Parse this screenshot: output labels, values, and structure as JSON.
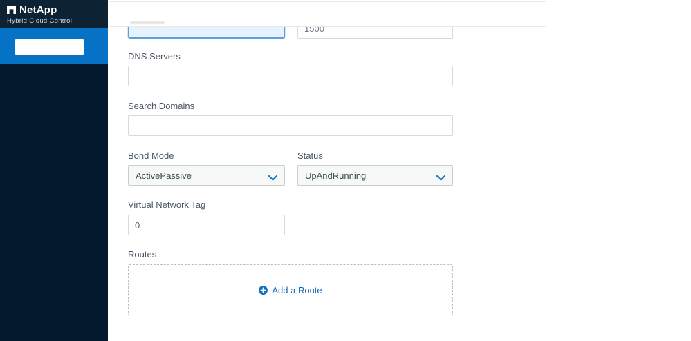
{
  "app": {
    "brand": "NetApp",
    "product": "Hybrid Cloud Control"
  },
  "form": {
    "row1": {
      "focused_value": "",
      "mtu_value": "1500"
    },
    "dns_servers": {
      "label": "DNS Servers",
      "value": ""
    },
    "search_domains": {
      "label": "Search Domains",
      "value": ""
    },
    "bond_mode": {
      "label": "Bond Mode",
      "value": "ActivePassive"
    },
    "status": {
      "label": "Status",
      "value": "UpAndRunning"
    },
    "virtual_network_tag": {
      "label": "Virtual Network Tag",
      "value": "0"
    },
    "routes": {
      "label": "Routes",
      "add_button_label": "Add a Route"
    }
  },
  "icons": {
    "logo": "netapp-logo-icon",
    "chevron": "chevron-down-icon",
    "add": "add-circle-icon"
  },
  "colors": {
    "sidebar_header_bg": "#0d2232",
    "sidebar_active_bg": "#0672c6",
    "sidebar_body_bg": "#041a2c",
    "accent_blue": "#1172bd",
    "link_blue": "#1267bd",
    "focus_border": "#5b9fdf",
    "focus_fill": "#e8f2fd",
    "input_border": "#d7d9db",
    "select_bg": "#f7f8f8",
    "label_text": "#4b5763",
    "divider": "#e7e8e9"
  }
}
